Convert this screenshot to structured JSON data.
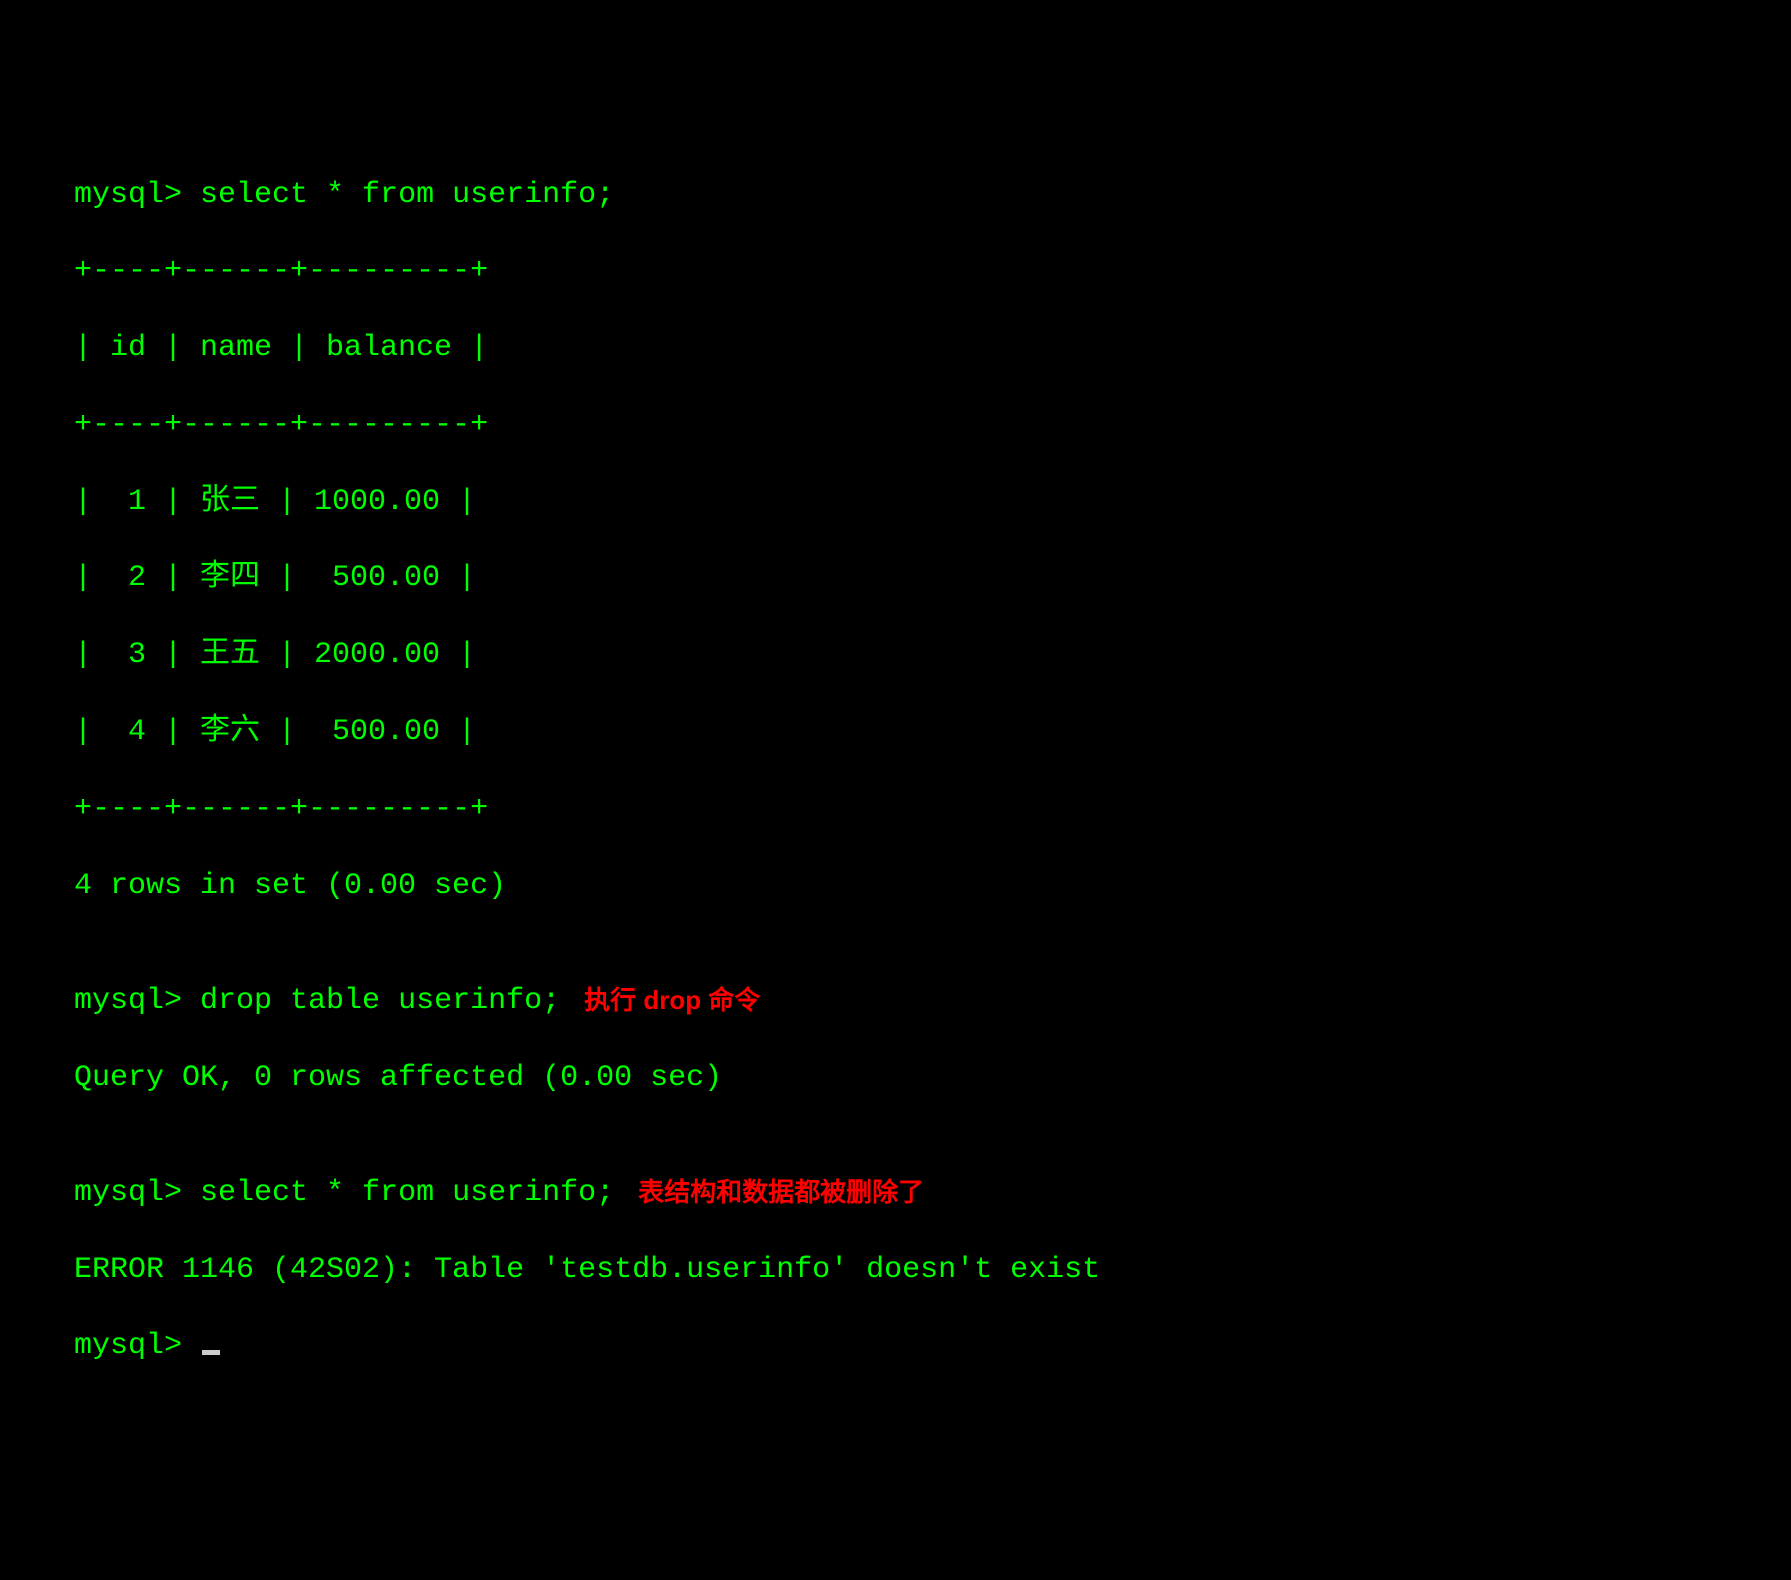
{
  "prompt": "mysql> ",
  "cmd1": "select * from userinfo;",
  "table": {
    "border_top": "+----+------+---------+",
    "header_row": "| id | name | balance |",
    "border_mid": "+----+------+---------+",
    "rows": [
      "|  1 | 张三 | 1000.00 |",
      "|  2 | 李四 |  500.00 |",
      "|  3 | 王五 | 2000.00 |",
      "|  4 | 李六 |  500.00 |"
    ],
    "border_bot": "+----+------+---------+"
  },
  "result1": "4 rows in set (0.00 sec)",
  "blank": "",
  "cmd2": "drop table userinfo;",
  "annot2": "执行 drop 命令",
  "result2": "Query OK, 0 rows affected (0.00 sec)",
  "cmd3": "select * from userinfo;",
  "annot3": "表结构和数据都被删除了",
  "error3": "ERROR 1146 (42S02): Table 'testdb.userinfo' doesn't exist",
  "chart_data": {
    "type": "table",
    "columns": [
      "id",
      "name",
      "balance"
    ],
    "rows": [
      {
        "id": 1,
        "name": "张三",
        "balance": 1000.0
      },
      {
        "id": 2,
        "name": "李四",
        "balance": 500.0
      },
      {
        "id": 3,
        "name": "王五",
        "balance": 2000.0
      },
      {
        "id": 4,
        "name": "李六",
        "balance": 500.0
      }
    ]
  }
}
